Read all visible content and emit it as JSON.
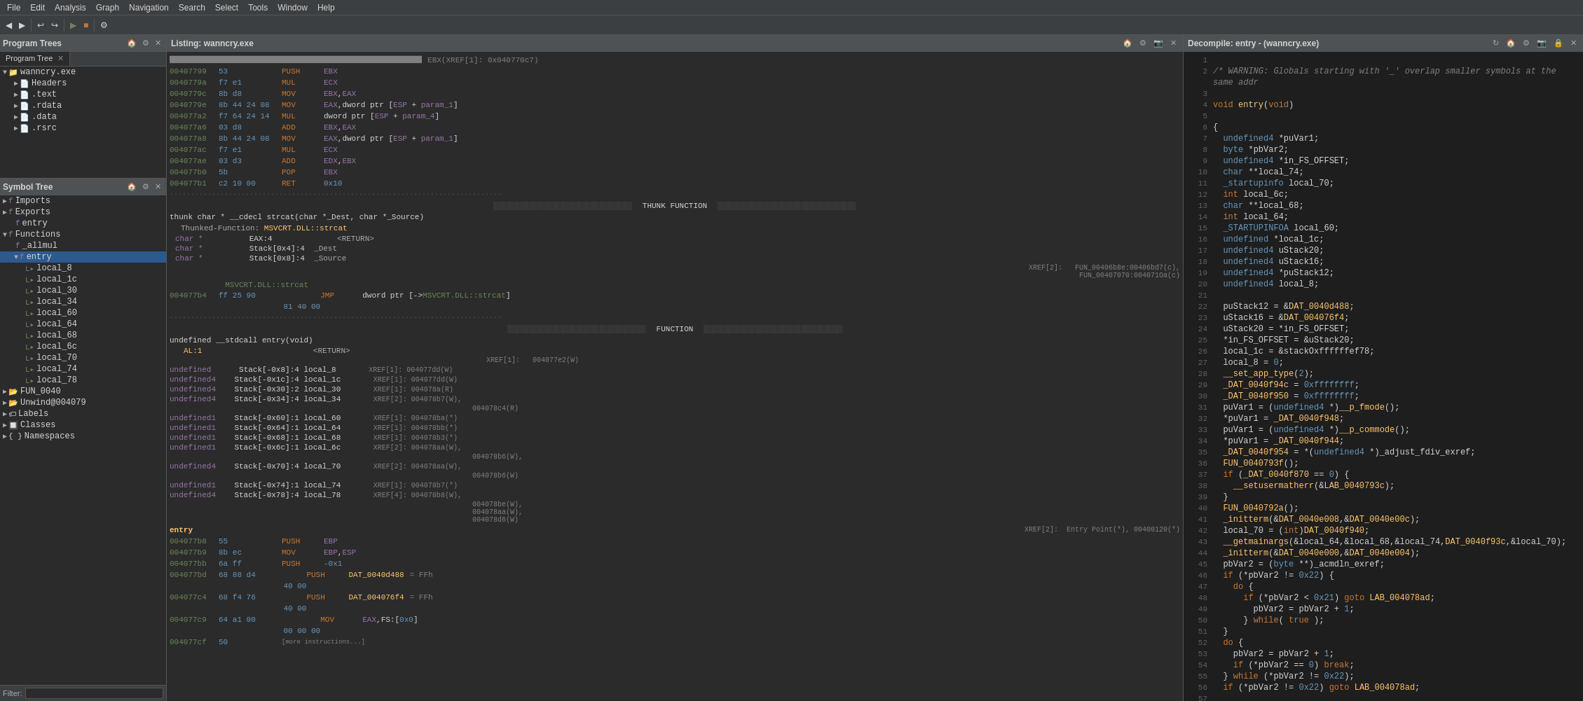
{
  "menu": {
    "items": [
      "File",
      "Edit",
      "Analysis",
      "Graph",
      "Navigation",
      "Search",
      "Select",
      "Tools",
      "Window",
      "Help"
    ]
  },
  "panels": {
    "left": {
      "title": "Program Trees",
      "tabs": [
        {
          "label": "Program Tree",
          "closable": true
        },
        {
          "label": "Symbol Tree",
          "closable": false
        }
      ]
    },
    "center": {
      "title": "Listing: wanncry.exe"
    },
    "right": {
      "title": "Decompile: entry - (wanncry.exe)"
    }
  },
  "tree": {
    "wanncry": {
      "label": "wanncry.exe",
      "children": [
        "Headers",
        ".text",
        ".rdata",
        ".data",
        ".rsrc"
      ]
    },
    "functions_section": {
      "label": "Functions",
      "children": [
        "_allmul",
        "entry"
      ]
    },
    "entry_vars": [
      "local_8",
      "local_1c",
      "local_30",
      "local_34",
      "local_60",
      "local_64",
      "local_68",
      "local_6c",
      "local_70",
      "local_74",
      "local_78"
    ],
    "other": [
      "FUN_0040",
      "Unwind@004079",
      "Labels",
      "Classes",
      "Namespaces"
    ]
  },
  "filter": {
    "label": "Filter:",
    "value": ""
  },
  "decompiler": {
    "warning": "/* WARNING: Globals starting with '_' overlap smaller symbols at the same addr",
    "lines": [
      {
        "num": 1,
        "code": ""
      },
      {
        "num": 2,
        "code": "/* WARNING: Globals starting with '_' overlap smaller symbols at the same addr"
      },
      {
        "num": 3,
        "code": ""
      },
      {
        "num": 4,
        "code": "void entry(void)"
      },
      {
        "num": 5,
        "code": ""
      },
      {
        "num": 6,
        "code": "{"
      },
      {
        "num": 7,
        "code": "  undefined4 *puVar1;"
      },
      {
        "num": 8,
        "code": "  byte *pbVar2;"
      },
      {
        "num": 9,
        "code": "  undefined4 *in_FS_OFFSET;"
      },
      {
        "num": 10,
        "code": "  char **local_74;"
      },
      {
        "num": 11,
        "code": "  _startupinfo local_70;"
      },
      {
        "num": 12,
        "code": "  int local_6c;"
      },
      {
        "num": 13,
        "code": "  char **local_68;"
      },
      {
        "num": 14,
        "code": "  int local_64;"
      },
      {
        "num": 15,
        "code": "  _STARTUPINFOA local_60;"
      },
      {
        "num": 16,
        "code": "  undefined *local_1c;"
      },
      {
        "num": 17,
        "code": "  undefined4 uStack20;"
      },
      {
        "num": 18,
        "code": "  undefined4 uStack16;"
      },
      {
        "num": 19,
        "code": "  undefined4 *puStack12;"
      },
      {
        "num": 20,
        "code": "  undefined4 local_8;"
      },
      {
        "num": 21,
        "code": ""
      },
      {
        "num": 22,
        "code": "  puStack12 = &DAT_0040d488;"
      },
      {
        "num": 23,
        "code": "  uStack16 = &DAT_004076f4;"
      },
      {
        "num": 24,
        "code": "  uStack20 = *in_FS_OFFSET;"
      },
      {
        "num": 25,
        "code": "  *in_FS_OFFSET = &uStack20;"
      },
      {
        "num": 26,
        "code": "  local_1c = &stackOxffffffef78;"
      },
      {
        "num": 27,
        "code": "  local_8 = 0;"
      },
      {
        "num": 28,
        "code": "  __set_app_type(2);"
      },
      {
        "num": 29,
        "code": "  _DAT_0040f94c = 0xffffffff;"
      },
      {
        "num": 30,
        "code": "  _DAT_0040f950 = 0xffffffff;"
      },
      {
        "num": 31,
        "code": "  puVar1 = (undefined4 *)__p_fmode();"
      },
      {
        "num": 32,
        "code": "  *puVar1 = _DAT_0040f948;"
      },
      {
        "num": 33,
        "code": "  puVar1 = (undefined4 *)__p_commode();"
      },
      {
        "num": 34,
        "code": "  *puVar1 = _DAT_0040f944;"
      },
      {
        "num": 35,
        "code": "  _DAT_0040f954 = *(undefined4 *)_adjust_fdiv_exref;"
      },
      {
        "num": 36,
        "code": "  FUN_0040793f();"
      },
      {
        "num": 37,
        "code": "  if (_DAT_0040f870 == 0) {"
      },
      {
        "num": 38,
        "code": "    __setusermatherr(&LAB_0040793c);"
      },
      {
        "num": 39,
        "code": "  }"
      },
      {
        "num": 40,
        "code": "  FUN_0040792a();"
      },
      {
        "num": 41,
        "code": "  _initterm(&DAT_0040e008,&DAT_0040e00c);"
      },
      {
        "num": 42,
        "code": "  local_70 = (int)DAT_0040f940;"
      },
      {
        "num": 43,
        "code": "  __getmainargs(&local_64,&local_68,&local_74,DAT_0040f93c,&local_70);"
      },
      {
        "num": 44,
        "code": "  _initterm(&DAT_0040e000,&DAT_0040e004);"
      },
      {
        "num": 45,
        "code": "  pbVar2 = (byte **)_acmdln_exref;"
      },
      {
        "num": 46,
        "code": "  if (*pbVar2 != 0x22) {"
      },
      {
        "num": 47,
        "code": "    do {"
      },
      {
        "num": 48,
        "code": "      if (*pbVar2 < 0x21) goto LAB_004078ad;"
      },
      {
        "num": 49,
        "code": "        pbVar2 = pbVar2 + 1;"
      },
      {
        "num": 50,
        "code": "      } while( true );"
      },
      {
        "num": 51,
        "code": "  }"
      },
      {
        "num": 52,
        "code": "  do {"
      },
      {
        "num": 53,
        "code": "    pbVar2 = pbVar2 + 1;"
      },
      {
        "num": 54,
        "code": "    if (*pbVar2 == 0) break;"
      },
      {
        "num": 55,
        "code": "  } while (*pbVar2 != 0x22);"
      },
      {
        "num": 56,
        "code": "  if (*pbVar2 != 0x22) goto LAB_004078ad;"
      },
      {
        "num": 57,
        "code": ""
      }
    ]
  }
}
